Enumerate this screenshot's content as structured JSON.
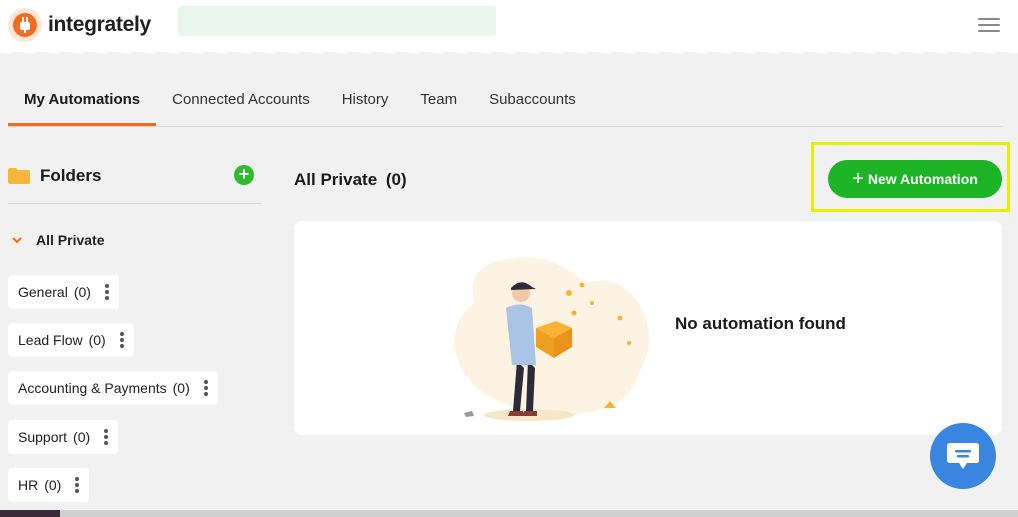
{
  "header": {
    "logo_text": "integrately",
    "menu_icon": "hamburger-menu-icon"
  },
  "tabs": [
    {
      "label": "My Automations",
      "active": true
    },
    {
      "label": "Connected Accounts",
      "active": false
    },
    {
      "label": "History",
      "active": false
    },
    {
      "label": "Team",
      "active": false
    },
    {
      "label": "Subaccounts",
      "active": false
    }
  ],
  "sidebar": {
    "title": "Folders",
    "add_icon": "plus-circle-icon",
    "group_label": "All Private",
    "folders": [
      {
        "name": "General",
        "count": "(0)"
      },
      {
        "name": "Lead Flow",
        "count": "(0)"
      },
      {
        "name": "Accounting & Payments",
        "count": "(0)"
      },
      {
        "name": "Support",
        "count": "(0)"
      },
      {
        "name": "HR",
        "count": "(0)"
      }
    ]
  },
  "main": {
    "section_title": "All Private",
    "section_count": "(0)",
    "new_button_label": "New Automation",
    "empty_message": "No automation found"
  },
  "colors": {
    "accent": "#f36b21",
    "primary_button": "#1db526",
    "highlight": "#e8f000",
    "chat": "#3a85e0"
  }
}
